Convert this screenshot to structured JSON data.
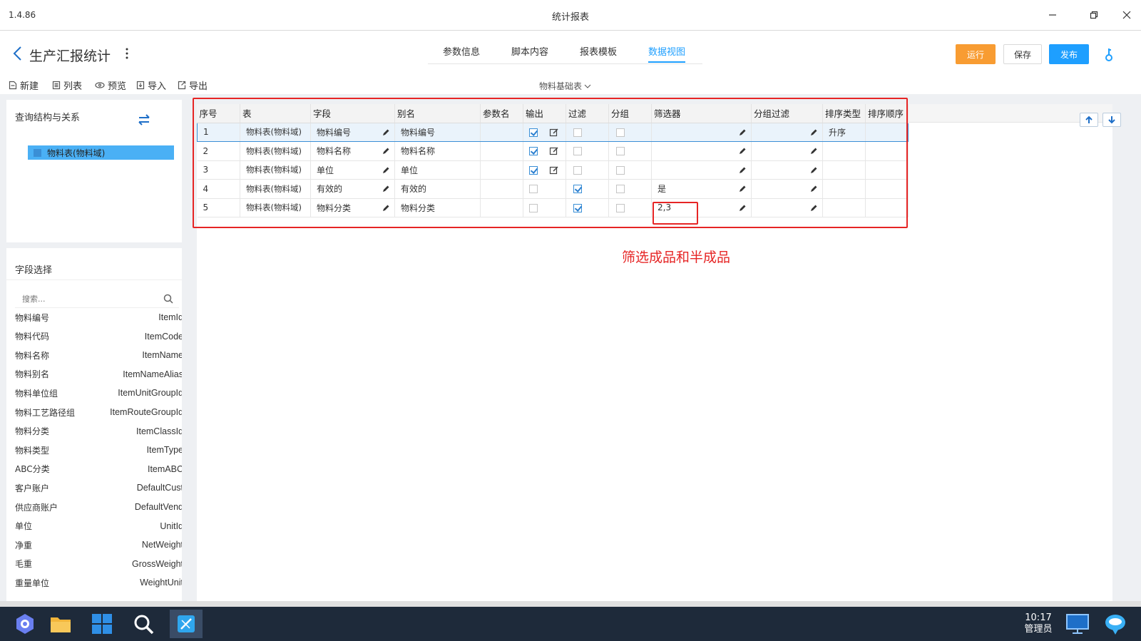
{
  "window": {
    "version": "1.4.86",
    "title": "统计报表"
  },
  "header": {
    "page_title": "生产汇报统计",
    "tabs": [
      {
        "label": "参数信息"
      },
      {
        "label": "脚本内容"
      },
      {
        "label": "报表模板"
      },
      {
        "label": "数据视图",
        "active": true
      }
    ],
    "buttons": {
      "run": "运行",
      "save": "保存",
      "publish": "发布"
    }
  },
  "toolbar": {
    "new": "新建",
    "list": "列表",
    "preview": "预览",
    "import": "导入",
    "export": "导出",
    "datasource": "物料基础表"
  },
  "left": {
    "query_title": "查询结构与关系",
    "tree_item": "物料表(物料域)",
    "field_title": "字段选择",
    "search_placeholder": "搜索...",
    "fields": [
      {
        "cn": "物料编号",
        "en": "ItemId"
      },
      {
        "cn": "物料代码",
        "en": "ItemCode"
      },
      {
        "cn": "物料名称",
        "en": "ItemName"
      },
      {
        "cn": "物料别名",
        "en": "ItemNameAlias"
      },
      {
        "cn": "物料单位组",
        "en": "ItemUnitGroupId"
      },
      {
        "cn": "物料工艺路径组",
        "en": "ItemRouteGroupId"
      },
      {
        "cn": "物料分类",
        "en": "ItemClassId"
      },
      {
        "cn": "物料类型",
        "en": "ItemType"
      },
      {
        "cn": "ABC分类",
        "en": "ItemABC"
      },
      {
        "cn": "客户账户",
        "en": "DefaultCust"
      },
      {
        "cn": "供应商账户",
        "en": "DefaultVend"
      },
      {
        "cn": "单位",
        "en": "UnitId"
      },
      {
        "cn": "净重",
        "en": "NetWeight"
      },
      {
        "cn": "毛重",
        "en": "GrossWeight"
      },
      {
        "cn": "重量单位",
        "en": "WeightUnit"
      }
    ]
  },
  "grid": {
    "columns": [
      "序号",
      "表",
      "字段",
      "别名",
      "参数名",
      "输出",
      "过滤",
      "分组",
      "筛选器",
      "分组过滤",
      "排序类型",
      "排序顺序"
    ],
    "rows": [
      {
        "no": "1",
        "table": "物料表(物料域)",
        "field": "物料编号",
        "alias": "物料编号",
        "param": "",
        "output": true,
        "filter": false,
        "group": false,
        "filter_value": "",
        "group_filter": "",
        "sort_type": "升序",
        "sort_order": "",
        "selected": true
      },
      {
        "no": "2",
        "table": "物料表(物料域)",
        "field": "物料名称",
        "alias": "物料名称",
        "param": "",
        "output": true,
        "filter": false,
        "group": false,
        "filter_value": "",
        "group_filter": "",
        "sort_type": "",
        "sort_order": ""
      },
      {
        "no": "3",
        "table": "物料表(物料域)",
        "field": "单位",
        "alias": "单位",
        "param": "",
        "output": true,
        "filter": false,
        "group": false,
        "filter_value": "",
        "group_filter": "",
        "sort_type": "",
        "sort_order": ""
      },
      {
        "no": "4",
        "table": "物料表(物料域)",
        "field": "有效的",
        "alias": "有效的",
        "param": "",
        "output": false,
        "filter": true,
        "group": false,
        "filter_value": "是",
        "group_filter": "",
        "sort_type": "",
        "sort_order": ""
      },
      {
        "no": "5",
        "table": "物料表(物料域)",
        "field": "物料分类",
        "alias": "物料分类",
        "param": "",
        "output": false,
        "filter": true,
        "group": false,
        "filter_value": "2,3",
        "group_filter": "",
        "sort_type": "",
        "sort_order": ""
      }
    ]
  },
  "annotation": "筛选成品和半成品",
  "taskbar": {
    "time": "10:17",
    "user": "管理员"
  },
  "colors": {
    "accent": "#1e9fff",
    "run": "#f89c32",
    "highlight": "#e62525"
  }
}
